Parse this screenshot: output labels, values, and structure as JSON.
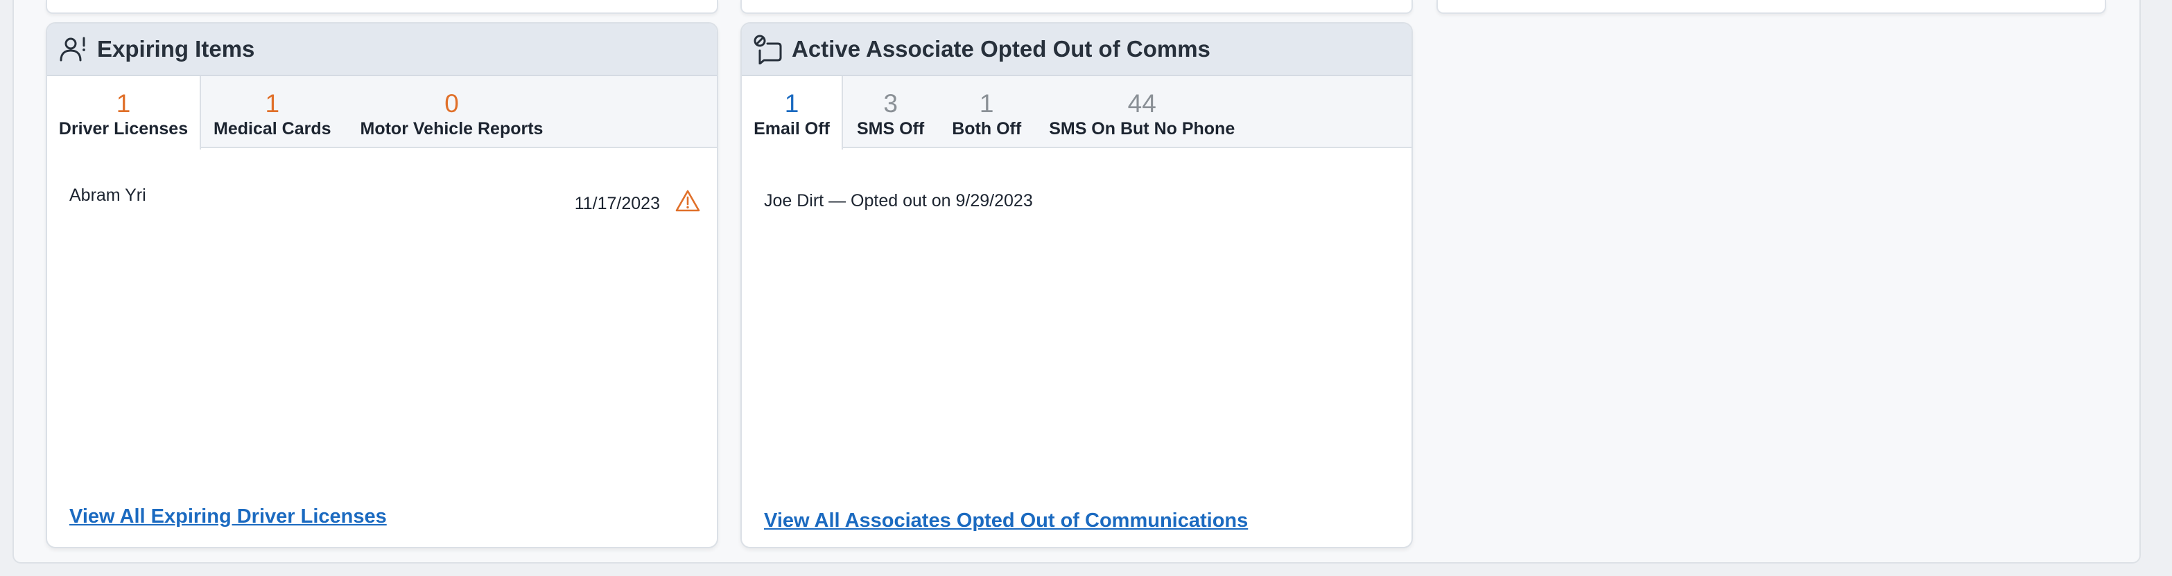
{
  "expiring_items": {
    "title": "Expiring Items",
    "tabs": [
      {
        "count": "1",
        "label": "Driver Licenses"
      },
      {
        "count": "1",
        "label": "Medical Cards"
      },
      {
        "count": "0",
        "label": "Motor Vehicle Reports"
      }
    ],
    "rows": [
      {
        "name": "Abram Yri",
        "date": "11/17/2023"
      }
    ],
    "footer_link": "View All Expiring Driver Licenses"
  },
  "opted_out": {
    "title": "Active Associate Opted Out of Comms",
    "tabs": [
      {
        "count": "1",
        "label": "Email Off"
      },
      {
        "count": "3",
        "label": "SMS Off"
      },
      {
        "count": "1",
        "label": "Both Off"
      },
      {
        "count": "44",
        "label": "SMS On But No Phone"
      }
    ],
    "rows": [
      {
        "text": "Joe Dirt — Opted out on 9/29/2023"
      }
    ],
    "footer_link": "View All Associates Opted Out of Communications"
  },
  "colors": {
    "accent_orange": "#e0702a",
    "accent_blue": "#1b6ac0",
    "muted_gray": "#8a9096",
    "header_bg": "#e3e8ef"
  }
}
